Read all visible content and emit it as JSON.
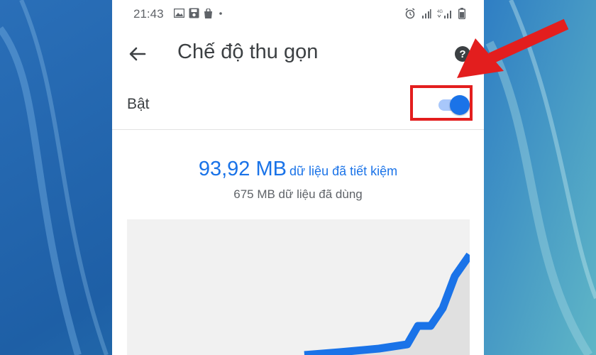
{
  "status_bar": {
    "time": "21:43",
    "left_icons": [
      "image-icon",
      "save-icon",
      "bag-icon",
      "dot-icon"
    ],
    "right_icons": [
      "alarm-icon",
      "signal-icon",
      "4g-signal-icon",
      "battery-icon"
    ]
  },
  "toolbar": {
    "title": "Chế độ thu gọn",
    "back_icon": "arrow-back-icon",
    "help_icon": "help-icon"
  },
  "lite_mode": {
    "label": "Bật",
    "enabled": true
  },
  "stats": {
    "saved_amount": "93,92 MB",
    "saved_text": "dữ liệu đã tiết kiệm",
    "used_text": "675 MB dữ liệu đã dùng"
  },
  "colors": {
    "accent": "#1a73e8",
    "toggle_track": "#a8c7fa",
    "annotation": "#e31e1e"
  },
  "annotation": {
    "highlight_target": "toggle-switch",
    "arrow": "red-arrow-icon"
  }
}
